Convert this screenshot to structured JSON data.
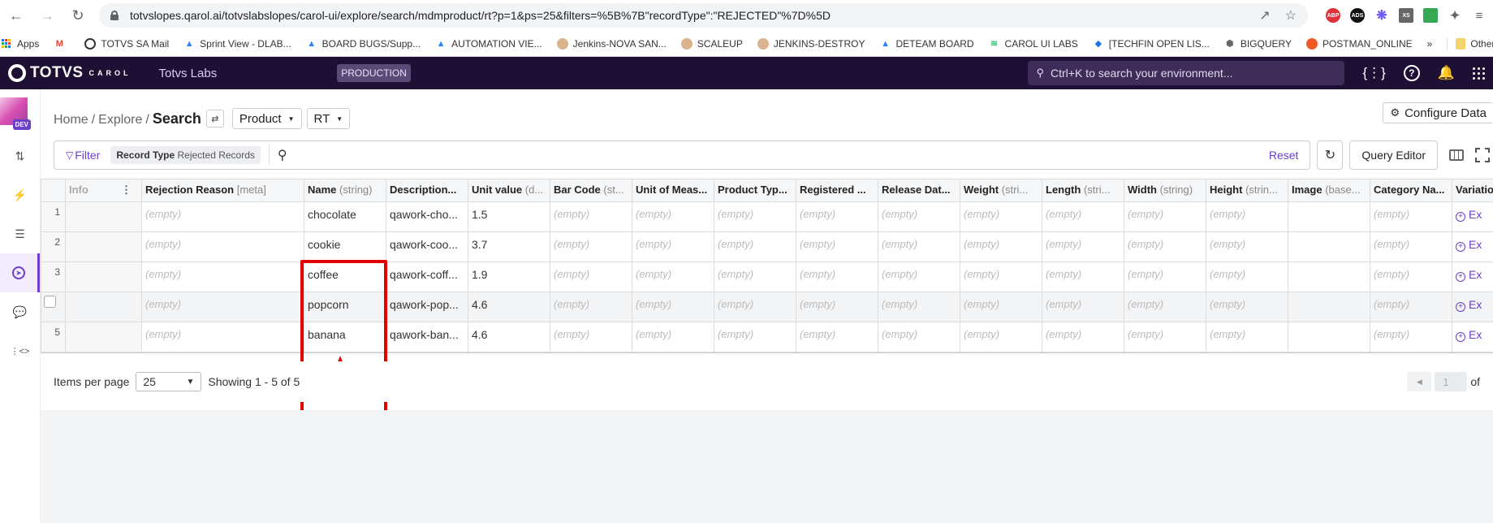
{
  "browser": {
    "url": "totvslopes.qarol.ai/totvslabslopes/carol-ui/explore/search/mdmproduct/rt?p=1&ps=25&filters=%5B%7B\"recordType\":\"REJECTED\"%7D%5D",
    "extensions": [
      "ABP",
      "ADS",
      "XS"
    ],
    "bookmarks": [
      {
        "label": "Apps",
        "icon": "apps-grid-icon"
      },
      {
        "label": "",
        "icon": "gmail-icon"
      },
      {
        "label": "TOTVS SA Mail",
        "icon": "totvs-icon"
      },
      {
        "label": "Sprint View - DLAB...",
        "icon": "jira-icon"
      },
      {
        "label": "BOARD BUGS/Supp...",
        "icon": "jira-icon"
      },
      {
        "label": "AUTOMATION VIE...",
        "icon": "jira-icon"
      },
      {
        "label": "Jenkins-NOVA SAN...",
        "icon": "jenkins-icon"
      },
      {
        "label": "SCALEUP",
        "icon": "jenkins-icon"
      },
      {
        "label": "JENKINS-DESTROY",
        "icon": "jenkins-icon"
      },
      {
        "label": "DETEAM BOARD",
        "icon": "jira-icon"
      },
      {
        "label": "CAROL UI LABS",
        "icon": "carol-icon"
      },
      {
        "label": "[TECHFIN OPEN LIS...",
        "icon": "diamond-icon"
      },
      {
        "label": "BIGQUERY",
        "icon": "bigquery-icon"
      },
      {
        "label": "POSTMAN_ONLINE",
        "icon": "postman-icon"
      }
    ],
    "more_bookmarks": "»",
    "other_bookmarks": "Other bookmarks"
  },
  "appnav": {
    "brand": "TOTVS",
    "brand_sub": "CAROL",
    "org": "Totvs Labs",
    "env": "PRODUCTION",
    "search_placeholder": "Ctrl+K to search your environment..."
  },
  "sidebar": {
    "badge": "DEV",
    "items": [
      {
        "icon": "pipeline-icon",
        "active": false
      },
      {
        "icon": "plug-icon",
        "active": false
      },
      {
        "icon": "database-icon",
        "active": false
      },
      {
        "icon": "compass-icon",
        "active": true
      },
      {
        "icon": "chat-icon",
        "active": false
      },
      {
        "icon": "code-icon",
        "active": false
      }
    ]
  },
  "header": {
    "breadcrumb": [
      "Home",
      "Explore"
    ],
    "current": "Search",
    "entity_dropdown": "Product",
    "type_dropdown": "RT",
    "configure_label": "Configure Data"
  },
  "toolbar": {
    "filter_label": "Filter",
    "chip_key": "Record Type",
    "chip_value": "Rejected Records",
    "reset_label": "Reset",
    "query_editor_label": "Query Editor"
  },
  "table": {
    "columns": [
      {
        "name": "Info",
        "type": ""
      },
      {
        "name": "Rejection Reason",
        "type": "[meta]"
      },
      {
        "name": "Name",
        "type": "(string)"
      },
      {
        "name": "Description...",
        "type": ""
      },
      {
        "name": "Unit value",
        "type": "(d..."
      },
      {
        "name": "Bar Code",
        "type": "(st..."
      },
      {
        "name": "Unit of Meas...",
        "type": ""
      },
      {
        "name": "Product Typ...",
        "type": ""
      },
      {
        "name": "Registered ...",
        "type": ""
      },
      {
        "name": "Release Dat...",
        "type": ""
      },
      {
        "name": "Weight",
        "type": "(stri..."
      },
      {
        "name": "Length",
        "type": "(stri..."
      },
      {
        "name": "Width",
        "type": "(string)"
      },
      {
        "name": "Height",
        "type": "(strin..."
      },
      {
        "name": "Image",
        "type": "(base..."
      },
      {
        "name": "Category Na...",
        "type": ""
      },
      {
        "name": "Variatio",
        "type": ""
      }
    ],
    "empty_text": "(empty)",
    "expand_label": "Ex",
    "rows": [
      {
        "num": "1",
        "name": "chocolate",
        "description": "qawork-cho...",
        "unit_value": "1.5"
      },
      {
        "num": "2",
        "name": "cookie",
        "description": "qawork-coo...",
        "unit_value": "3.7"
      },
      {
        "num": "3",
        "name": "coffee",
        "description": "qawork-coff...",
        "unit_value": "1.9"
      },
      {
        "num": "",
        "name": "popcorn",
        "description": "qawork-pop...",
        "unit_value": "4.6",
        "hovered": true
      },
      {
        "num": "5",
        "name": "banana",
        "description": "qawork-ban...",
        "unit_value": "4.6"
      }
    ]
  },
  "pagination": {
    "items_per_page_label": "Items per page",
    "items_per_page": "25",
    "showing": "Showing 1 - 5 of 5",
    "page": "1",
    "of_label": "of"
  },
  "colors": {
    "accent": "#6b3fc9",
    "nav_bg": "#1e1035",
    "annotation": "#e00000"
  }
}
